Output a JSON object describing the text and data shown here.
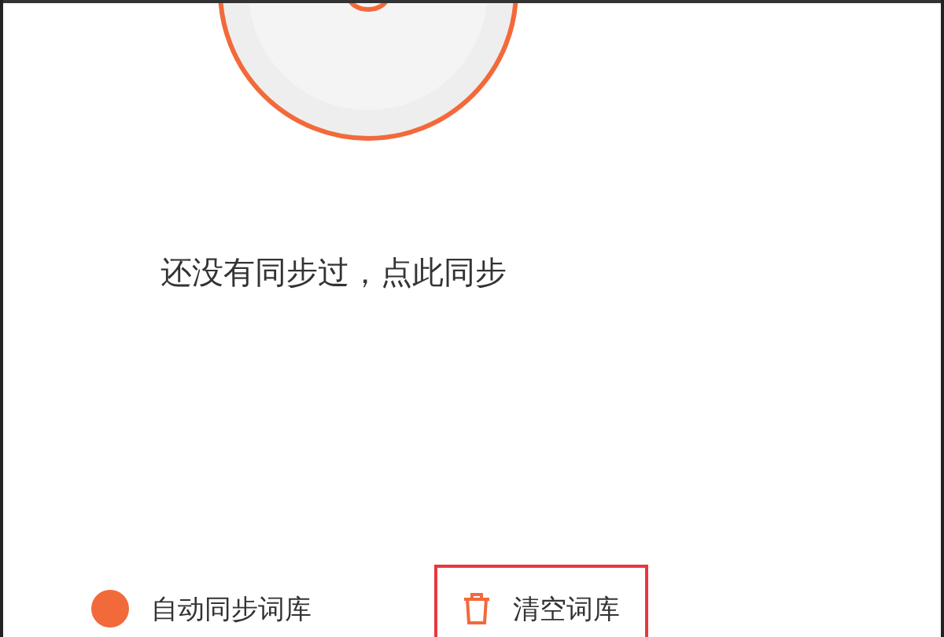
{
  "sync_prompt": "还没有同步过，点此同步",
  "actions": [
    {
      "kind": "toggle",
      "label": "自动同步词库",
      "highlighted": false
    },
    {
      "kind": "clear",
      "label": "清空词库",
      "highlighted": true
    }
  ]
}
